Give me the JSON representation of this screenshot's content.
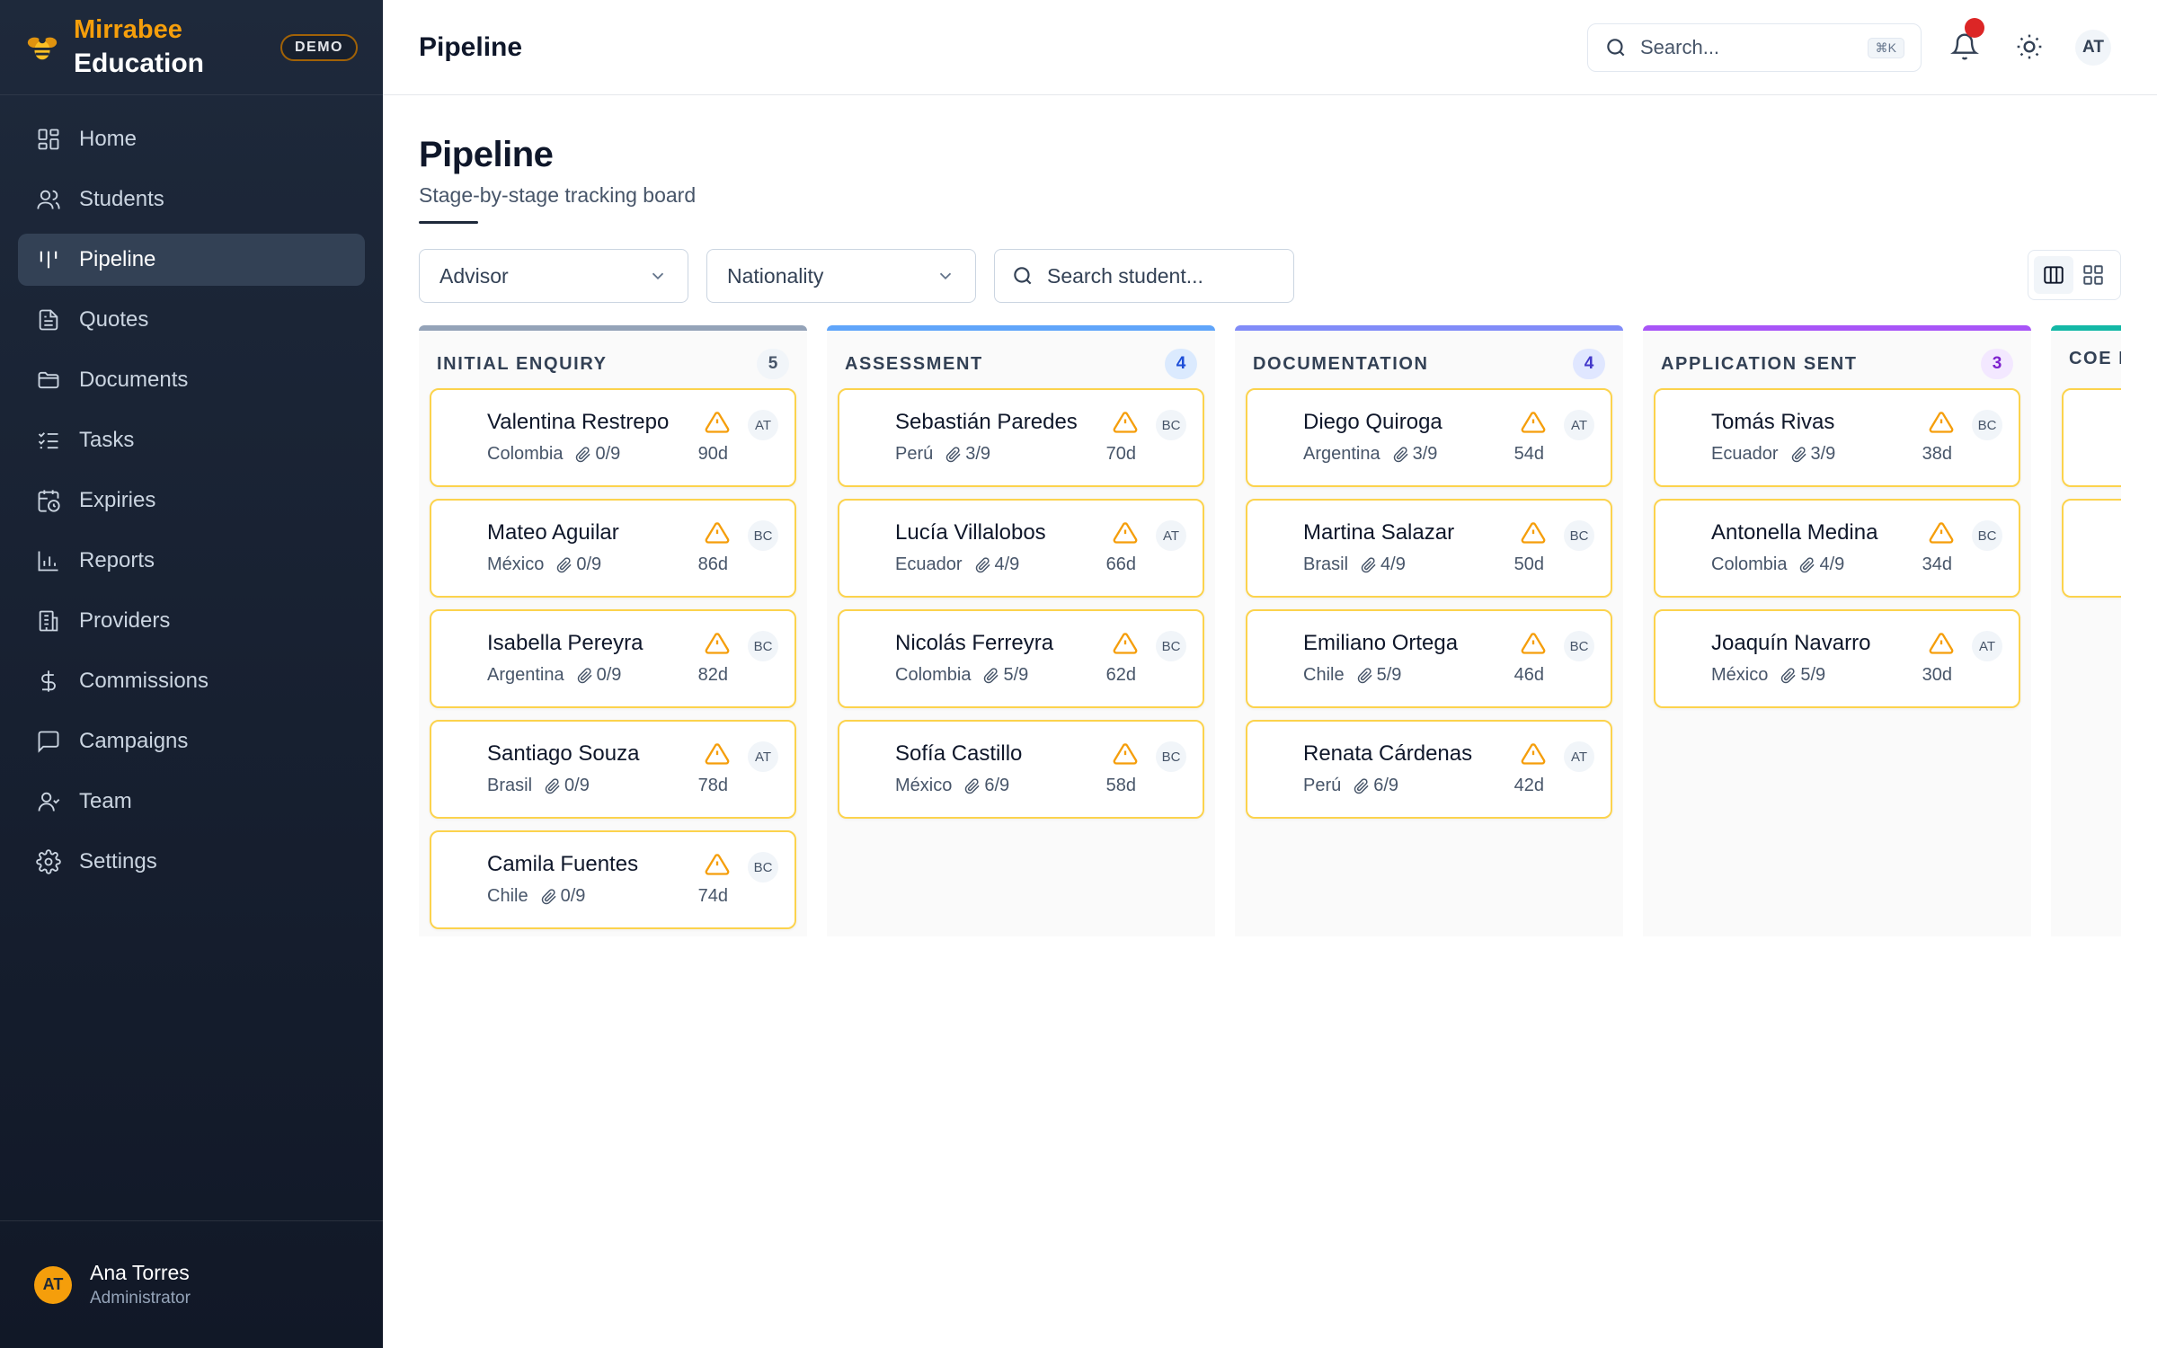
{
  "brand": {
    "name": "Mirrabee",
    "subtitle": "Education",
    "badge": "DEMO"
  },
  "sidebar": {
    "items": [
      {
        "label": "Home",
        "icon": "grid-icon"
      },
      {
        "label": "Students",
        "icon": "users-icon"
      },
      {
        "label": "Pipeline",
        "icon": "pipeline-icon",
        "active": true
      },
      {
        "label": "Quotes",
        "icon": "file-text-icon"
      },
      {
        "label": "Documents",
        "icon": "folder-icon"
      },
      {
        "label": "Tasks",
        "icon": "checklist-icon"
      },
      {
        "label": "Expiries",
        "icon": "calendar-clock-icon"
      },
      {
        "label": "Reports",
        "icon": "bar-chart-icon"
      },
      {
        "label": "Providers",
        "icon": "building-icon"
      },
      {
        "label": "Commissions",
        "icon": "dollar-icon"
      },
      {
        "label": "Campaigns",
        "icon": "message-square-icon"
      },
      {
        "label": "Team",
        "icon": "user-icon"
      },
      {
        "label": "Settings",
        "icon": "gear-icon"
      }
    ],
    "user": {
      "initials": "AT",
      "name": "Ana Torres",
      "role": "Administrator"
    }
  },
  "header": {
    "title": "Pipeline",
    "search_placeholder": "Search...",
    "search_shortcut": "⌘K",
    "user_initials": "AT"
  },
  "page": {
    "title": "Pipeline",
    "subtitle": "Stage-by-stage tracking board"
  },
  "filters": {
    "advisor": "Advisor",
    "nationality": "Nationality",
    "search_placeholder": "Search student..."
  },
  "colors": {
    "accent": "#f59e0b",
    "card_border": "#fcd34d",
    "warning": "#f59e0b"
  },
  "columns": [
    {
      "title": "INITIAL ENQUIRY",
      "count": "5",
      "color": "#94a3b8",
      "badge_bg": "#f1f5f9",
      "badge_fg": "#475569",
      "cards": [
        {
          "name": "Valentina Restrepo",
          "country": "Colombia",
          "docs": "0/9",
          "days": "90d",
          "advisor": "AT"
        },
        {
          "name": "Mateo Aguilar",
          "country": "México",
          "docs": "0/9",
          "days": "86d",
          "advisor": "BC"
        },
        {
          "name": "Isabella Pereyra",
          "country": "Argentina",
          "docs": "0/9",
          "days": "82d",
          "advisor": "BC"
        },
        {
          "name": "Santiago Souza",
          "country": "Brasil",
          "docs": "0/9",
          "days": "78d",
          "advisor": "AT"
        },
        {
          "name": "Camila Fuentes",
          "country": "Chile",
          "docs": "0/9",
          "days": "74d",
          "advisor": "BC"
        }
      ]
    },
    {
      "title": "ASSESSMENT",
      "count": "4",
      "color": "#60a5fa",
      "badge_bg": "#dbeafe",
      "badge_fg": "#1d4ed8",
      "cards": [
        {
          "name": "Sebastián Paredes",
          "country": "Perú",
          "docs": "3/9",
          "days": "70d",
          "advisor": "BC"
        },
        {
          "name": "Lucía Villalobos",
          "country": "Ecuador",
          "docs": "4/9",
          "days": "66d",
          "advisor": "AT"
        },
        {
          "name": "Nicolás Ferreyra",
          "country": "Colombia",
          "docs": "5/9",
          "days": "62d",
          "advisor": "BC"
        },
        {
          "name": "Sofía Castillo",
          "country": "México",
          "docs": "6/9",
          "days": "58d",
          "advisor": "BC"
        }
      ]
    },
    {
      "title": "DOCUMENTATION",
      "count": "4",
      "color": "#818cf8",
      "badge_bg": "#e0e7ff",
      "badge_fg": "#4338ca",
      "cards": [
        {
          "name": "Diego Quiroga",
          "country": "Argentina",
          "docs": "3/9",
          "days": "54d",
          "advisor": "AT"
        },
        {
          "name": "Martina Salazar",
          "country": "Brasil",
          "docs": "4/9",
          "days": "50d",
          "advisor": "BC"
        },
        {
          "name": "Emiliano Ortega",
          "country": "Chile",
          "docs": "5/9",
          "days": "46d",
          "advisor": "BC"
        },
        {
          "name": "Renata Cárdenas",
          "country": "Perú",
          "docs": "6/9",
          "days": "42d",
          "advisor": "AT"
        }
      ]
    },
    {
      "title": "APPLICATION SENT",
      "count": "3",
      "color": "#a855f7",
      "badge_bg": "#f3e8ff",
      "badge_fg": "#7e22ce",
      "cards": [
        {
          "name": "Tomás Rivas",
          "country": "Ecuador",
          "docs": "3/9",
          "days": "38d",
          "advisor": "BC"
        },
        {
          "name": "Antonella Medina",
          "country": "Colombia",
          "docs": "4/9",
          "days": "34d",
          "advisor": "BC"
        },
        {
          "name": "Joaquín Navarro",
          "country": "México",
          "docs": "5/9",
          "days": "30d",
          "advisor": "AT"
        }
      ]
    },
    {
      "title": "COE R",
      "count": "",
      "color": "#14b8a6",
      "badge_bg": "#ccfbf1",
      "badge_fg": "#0f766e",
      "cards": [
        {
          "name": "",
          "country": "",
          "docs": "",
          "days": "",
          "advisor": ""
        },
        {
          "name": "",
          "country": "",
          "docs": "",
          "days": "",
          "advisor": ""
        }
      ]
    }
  ]
}
